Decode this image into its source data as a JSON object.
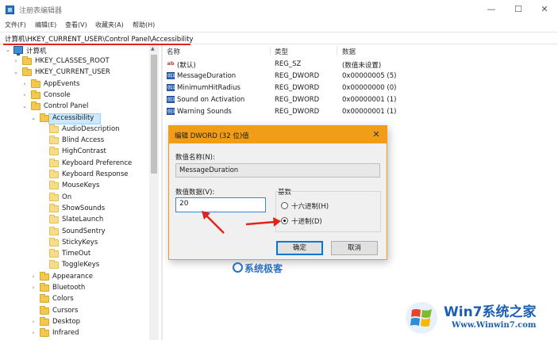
{
  "window": {
    "title": "注册表编辑器",
    "minimize": "—",
    "maximize": "☐",
    "close": "✕"
  },
  "menu": [
    "文件(F)",
    "编辑(E)",
    "查看(V)",
    "收藏夹(A)",
    "帮助(H)"
  ],
  "address": "计算机\\HKEY_CURRENT_USER\\Control Panel\\Accessibility",
  "tree": {
    "root": "计算机",
    "items": [
      {
        "label": "HKEY_CLASSES_ROOT",
        "arrow": "›"
      },
      {
        "label": "HKEY_CURRENT_USER",
        "arrow": "⌄"
      },
      {
        "label": "AppEvents",
        "arrow": "›"
      },
      {
        "label": "Console",
        "arrow": "›"
      },
      {
        "label": "Control Panel",
        "arrow": "⌄"
      },
      {
        "label": "Accessibility",
        "arrow": "⌄"
      },
      {
        "label": "AudioDescription",
        "arrow": ""
      },
      {
        "label": "Blind Access",
        "arrow": ""
      },
      {
        "label": "HighContrast",
        "arrow": ""
      },
      {
        "label": "Keyboard Preference",
        "arrow": ""
      },
      {
        "label": "Keyboard Response",
        "arrow": ""
      },
      {
        "label": "MouseKeys",
        "arrow": ""
      },
      {
        "label": "On",
        "arrow": ""
      },
      {
        "label": "ShowSounds",
        "arrow": ""
      },
      {
        "label": "SlateLaunch",
        "arrow": ""
      },
      {
        "label": "SoundSentry",
        "arrow": ""
      },
      {
        "label": "StickyKeys",
        "arrow": ""
      },
      {
        "label": "TimeOut",
        "arrow": ""
      },
      {
        "label": "ToggleKeys",
        "arrow": ""
      },
      {
        "label": "Appearance",
        "arrow": "›"
      },
      {
        "label": "Bluetooth",
        "arrow": "›"
      },
      {
        "label": "Colors",
        "arrow": ""
      },
      {
        "label": "Cursors",
        "arrow": ""
      },
      {
        "label": "Desktop",
        "arrow": "›"
      },
      {
        "label": "Infrared",
        "arrow": "›"
      }
    ]
  },
  "list": {
    "headers": {
      "name": "名称",
      "type": "类型",
      "data": "数据"
    },
    "rows": [
      {
        "icon": "ab",
        "name": "(默认)",
        "type": "REG_SZ",
        "data": "(数值未设置)"
      },
      {
        "icon": "011",
        "name": "MessageDuration",
        "type": "REG_DWORD",
        "data": "0x00000005 (5)"
      },
      {
        "icon": "011",
        "name": "MinimumHitRadius",
        "type": "REG_DWORD",
        "data": "0x00000000 (0)"
      },
      {
        "icon": "011",
        "name": "Sound on Activation",
        "type": "REG_DWORD",
        "data": "0x00000001 (1)"
      },
      {
        "icon": "011",
        "name": "Warning Sounds",
        "type": "REG_DWORD",
        "data": "0x00000001 (1)"
      }
    ]
  },
  "dialog": {
    "title": "编辑 DWORD (32 位)值",
    "close": "✕",
    "name_label": "数值名称(N):",
    "name_value": "MessageDuration",
    "data_label": "数值数据(V):",
    "data_value": "20",
    "base_label": "基数",
    "radio_hex": "十六进制(H)",
    "radio_dec": "十进制(D)",
    "ok": "确定",
    "cancel": "取消"
  },
  "watermark": "系统极客",
  "logo": {
    "title": "Win7系统之家",
    "url": "Www.Winwin7.com"
  },
  "colors": {
    "accent": "#f29d18",
    "annotation": "#e0241b",
    "selection": "#cce8ff"
  }
}
